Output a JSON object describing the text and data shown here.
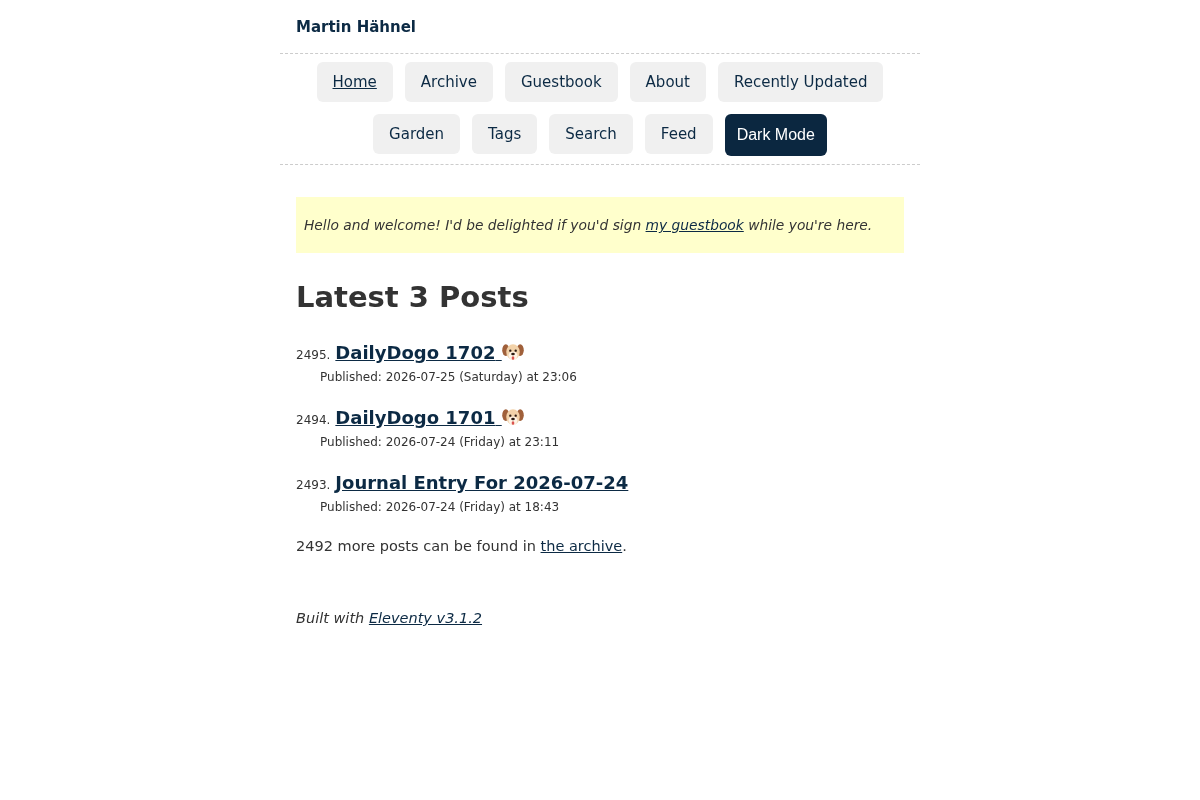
{
  "site_title": "Martin Hähnel",
  "nav": {
    "items": [
      {
        "label": "Home",
        "kind": "link",
        "selected": true
      },
      {
        "label": "Archive",
        "kind": "link",
        "selected": false
      },
      {
        "label": "Guestbook",
        "kind": "link",
        "selected": false
      },
      {
        "label": "About",
        "kind": "link",
        "selected": false
      },
      {
        "label": "Recently Updated",
        "kind": "link",
        "selected": false
      },
      {
        "label": "Garden",
        "kind": "link",
        "selected": false
      },
      {
        "label": "Tags",
        "kind": "link",
        "selected": false
      },
      {
        "label": "Search",
        "kind": "link",
        "selected": false
      },
      {
        "label": "Feed",
        "kind": "link",
        "selected": false
      },
      {
        "label": "Dark Mode",
        "kind": "toggle",
        "selected": false
      }
    ]
  },
  "notice": {
    "text_before": "Hello and welcome! I'd be delighted if you'd sign ",
    "link": "my guestbook",
    "text_after": " while you're here."
  },
  "heading": "Latest 3 Posts",
  "posts": [
    {
      "number": "2495.",
      "title": "DailyDogo 1702",
      "kind": "dogo",
      "published": "Published: 2026-07-25 (Saturday) at 23:06"
    },
    {
      "number": "2494.",
      "title": "DailyDogo 1701",
      "kind": "dogo",
      "published": "Published: 2026-07-24 (Friday) at 23:11"
    },
    {
      "number": "2493.",
      "title": "Journal Entry For 2026-07-24",
      "kind": "journal",
      "published": "Published: 2026-07-24 (Friday) at 18:43"
    }
  ],
  "more": {
    "text_before": "2492 more posts can be found in ",
    "link": "the archive",
    "text_after": "."
  },
  "footer": {
    "text_before": "Built with ",
    "link": "Eleventy v3.1.2"
  }
}
